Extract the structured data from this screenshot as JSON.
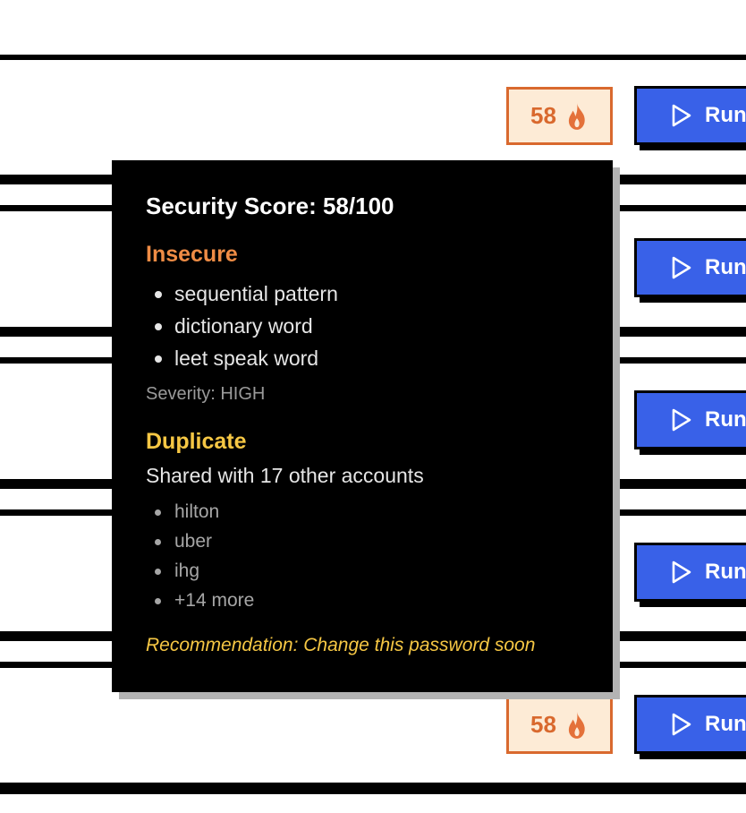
{
  "rows": [
    {
      "score": "58",
      "run_label": "Run"
    },
    {
      "score": "",
      "run_label": "Run"
    },
    {
      "score": "",
      "run_label": "Run"
    },
    {
      "score": "",
      "run_label": "Run"
    },
    {
      "score": "58",
      "run_label": "Run"
    }
  ],
  "badge_icon": "flame-icon",
  "run_icon": "play-icon",
  "tooltip": {
    "title": "Security Score: 58/100",
    "insecure_heading": "Insecure",
    "issues": [
      "sequential pattern",
      "dictionary word",
      "leet speak word"
    ],
    "severity": "Severity: HIGH",
    "duplicate_heading": "Duplicate",
    "shared_text": "Shared with 17 other accounts",
    "accounts": [
      "hilton",
      "uber",
      "ihg",
      "+14 more"
    ],
    "recommendation": "Recommendation: Change this password soon"
  },
  "colors": {
    "badge_accent": "#d9692e",
    "badge_bg": "#fdebd6",
    "run_button": "#3961e8",
    "insecure": "#ef8c45",
    "duplicate": "#f6c744"
  }
}
